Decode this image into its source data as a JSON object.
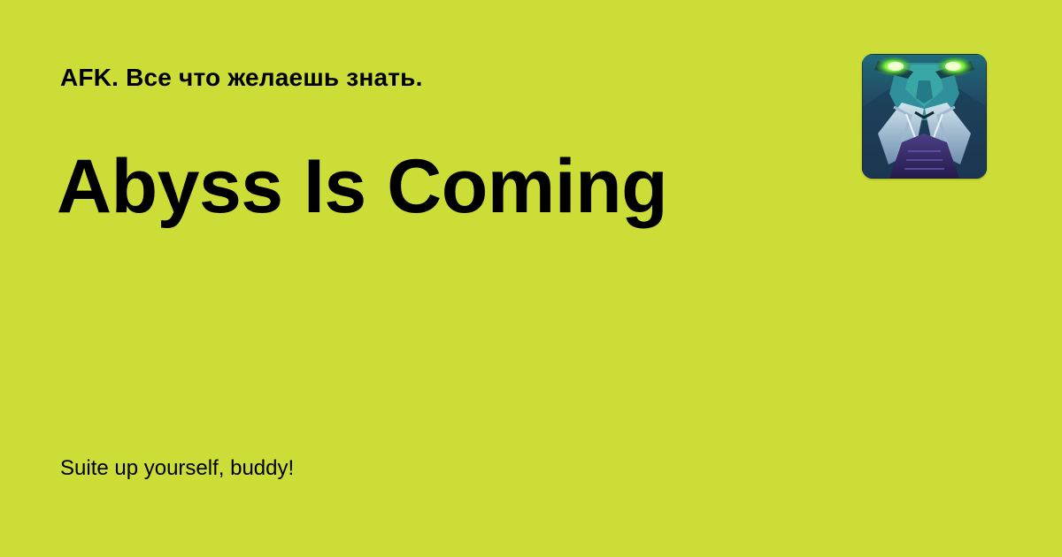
{
  "header": {
    "site_name": "AFK. Все что желаешь знать."
  },
  "main": {
    "title": "Abyss Is Coming",
    "tagline": "Suite up yourself, buddy!"
  },
  "app_icon": {
    "icon": "dark-demon-face-icon",
    "accent_color": "#7cf43a"
  },
  "colors": {
    "background": "#cddd37",
    "text": "#000000"
  }
}
